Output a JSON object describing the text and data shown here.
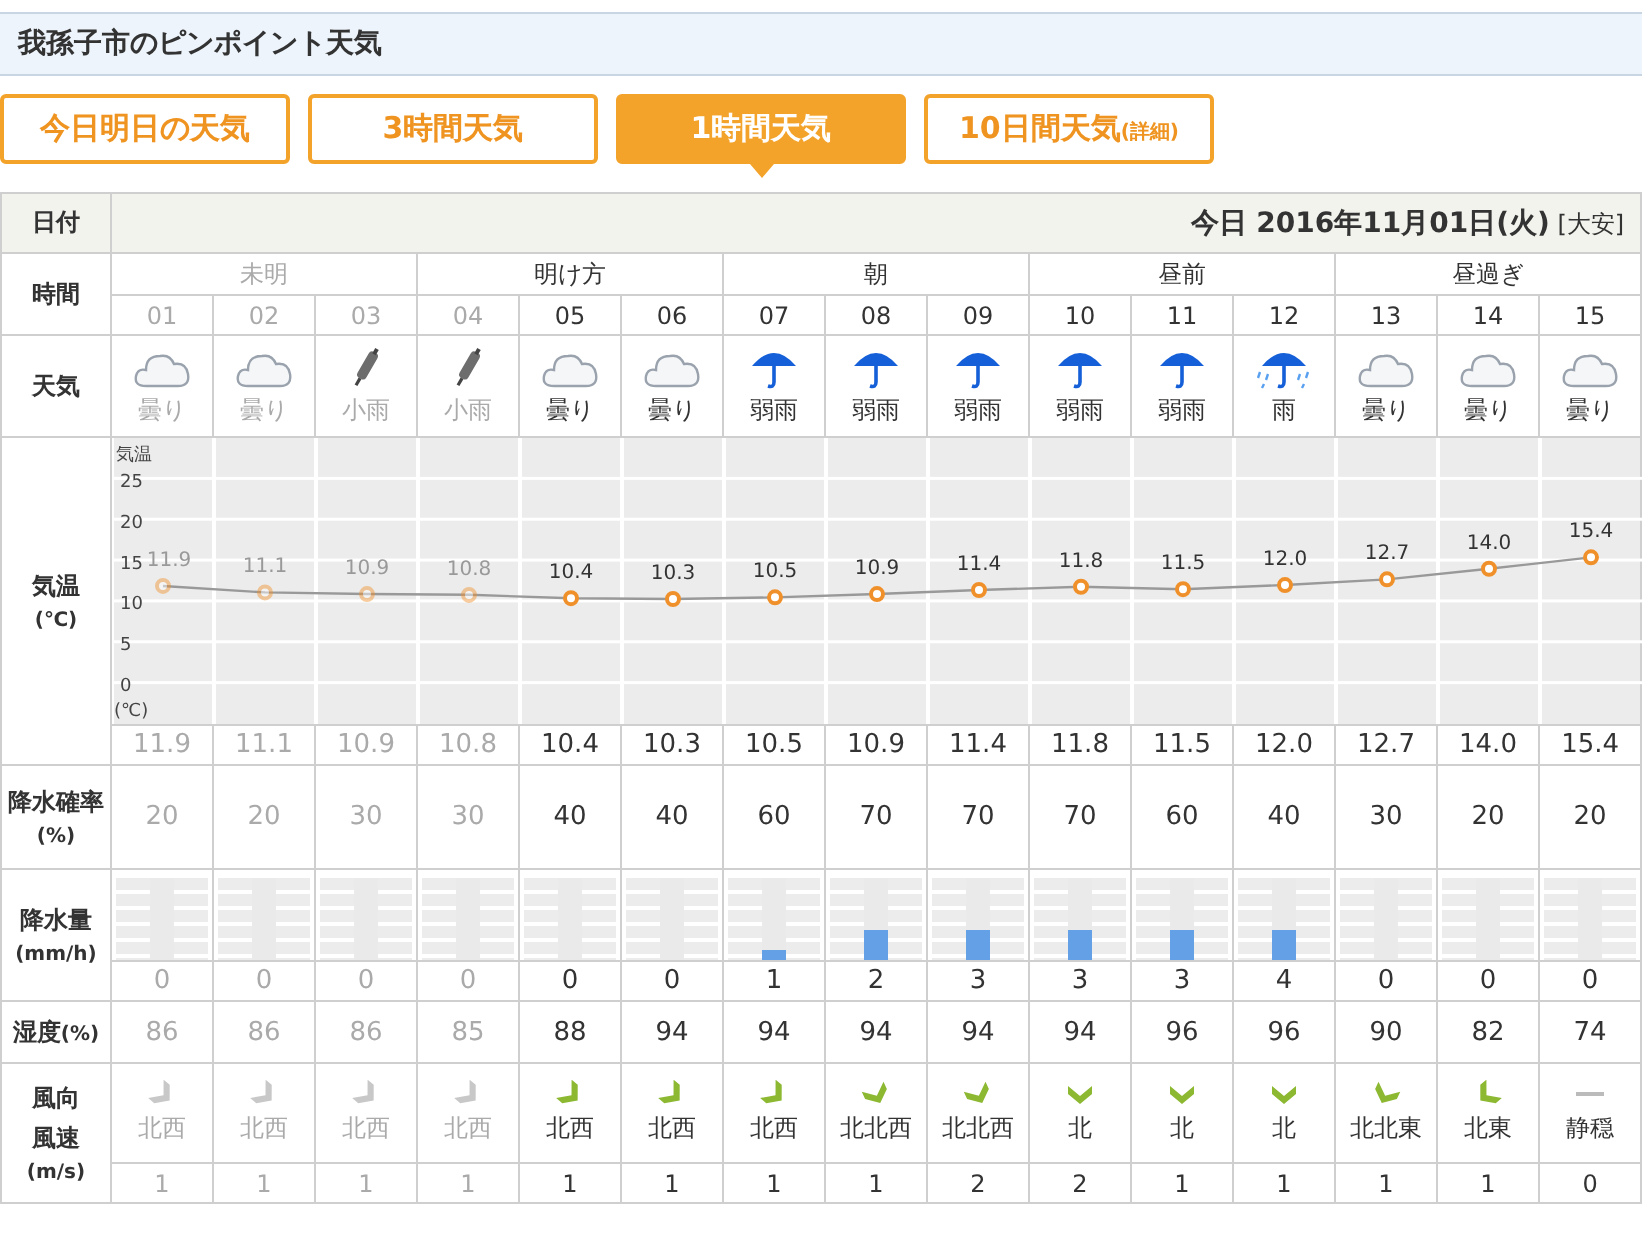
{
  "title": "我孫子市のピンポイント天気",
  "tabs": [
    {
      "label": "今日明日の天気",
      "selected": false
    },
    {
      "label": "3時間天気",
      "selected": false
    },
    {
      "label": "1時間天気",
      "selected": true
    },
    {
      "label": "10日間天気",
      "suffix": "(詳細)",
      "selected": false
    }
  ],
  "labels": {
    "date": "日付",
    "time": "時間",
    "weather": "天気",
    "temperature": "気温",
    "temperature_unit": "(℃)",
    "precip_prob": "降水確率",
    "precip_prob_unit": "(%)",
    "precip": "降水量",
    "precip_unit": "(mm/h)",
    "humidity": "湿度",
    "humidity_unit": "(%)",
    "wind_dir": "風向",
    "wind_speed": "風速",
    "wind_unit": "(m/s)"
  },
  "date": {
    "text": "今日 2016年11月01日(火)",
    "rokuyo": "[大安]"
  },
  "periods": [
    {
      "label": "未明",
      "past": true,
      "hours": [
        {
          "time": "01",
          "past": true,
          "kind": "cloud",
          "weather": "曇り",
          "temp": "11.9",
          "prob": "20",
          "precip": "0",
          "humidity": "86",
          "wind": {
            "kind": "nw",
            "direction": "北西"
          },
          "speed": "1"
        },
        {
          "time": "02",
          "past": true,
          "kind": "cloud",
          "weather": "曇り",
          "temp": "11.1",
          "prob": "20",
          "precip": "0",
          "humidity": "86",
          "wind": {
            "kind": "nw",
            "direction": "北西"
          },
          "speed": "1"
        },
        {
          "time": "03",
          "past": true,
          "kind": "closed-umbrella",
          "weather": "小雨",
          "temp": "10.9",
          "prob": "30",
          "precip": "0",
          "humidity": "86",
          "wind": {
            "kind": "nw",
            "direction": "北西"
          },
          "speed": "1"
        }
      ]
    },
    {
      "label": "明け方",
      "past": false,
      "hours": [
        {
          "time": "04",
          "past": true,
          "kind": "closed-umbrella",
          "weather": "小雨",
          "temp": "10.8",
          "prob": "30",
          "precip": "0",
          "humidity": "85",
          "wind": {
            "kind": "nw",
            "direction": "北西"
          },
          "speed": "1"
        },
        {
          "time": "05",
          "past": false,
          "kind": "cloud",
          "weather": "曇り",
          "temp": "10.4",
          "prob": "40",
          "precip": "0",
          "humidity": "88",
          "wind": {
            "kind": "nw",
            "direction": "北西"
          },
          "speed": "1"
        },
        {
          "time": "06",
          "past": false,
          "kind": "cloud",
          "weather": "曇り",
          "temp": "10.3",
          "prob": "40",
          "precip": "0",
          "humidity": "94",
          "wind": {
            "kind": "nw",
            "direction": "北西"
          },
          "speed": "1"
        }
      ]
    },
    {
      "label": "朝",
      "past": false,
      "hours": [
        {
          "time": "07",
          "past": false,
          "kind": "umbrella",
          "weather": "弱雨",
          "temp": "10.5",
          "prob": "60",
          "precip": "1",
          "level": 0.12,
          "humidity": "94",
          "wind": {
            "kind": "nw",
            "direction": "北西"
          },
          "speed": "1"
        },
        {
          "time": "08",
          "past": false,
          "kind": "umbrella",
          "weather": "弱雨",
          "temp": "10.9",
          "prob": "70",
          "precip": "2",
          "level": 0.37,
          "humidity": "94",
          "wind": {
            "kind": "nnw",
            "direction": "北北西"
          },
          "speed": "1"
        },
        {
          "time": "09",
          "past": false,
          "kind": "umbrella",
          "weather": "弱雨",
          "temp": "11.4",
          "prob": "70",
          "precip": "3",
          "level": 0.37,
          "humidity": "94",
          "wind": {
            "kind": "nnw",
            "direction": "北北西"
          },
          "speed": "2"
        }
      ]
    },
    {
      "label": "昼前",
      "past": false,
      "hours": [
        {
          "time": "10",
          "past": false,
          "kind": "umbrella",
          "weather": "弱雨",
          "temp": "11.8",
          "prob": "70",
          "precip": "3",
          "level": 0.37,
          "humidity": "94",
          "wind": {
            "kind": "n",
            "direction": "北"
          },
          "speed": "2"
        },
        {
          "time": "11",
          "past": false,
          "kind": "umbrella",
          "weather": "弱雨",
          "temp": "11.5",
          "prob": "60",
          "precip": "3",
          "level": 0.37,
          "humidity": "96",
          "wind": {
            "kind": "n",
            "direction": "北"
          },
          "speed": "1"
        },
        {
          "time": "12",
          "past": false,
          "kind": "umbrella-rain",
          "weather": "雨",
          "temp": "12.0",
          "prob": "40",
          "precip": "4",
          "level": 0.37,
          "humidity": "96",
          "wind": {
            "kind": "n",
            "direction": "北"
          },
          "speed": "1"
        }
      ]
    },
    {
      "label": "昼過ぎ",
      "past": false,
      "hours": [
        {
          "time": "13",
          "past": false,
          "kind": "cloud",
          "weather": "曇り",
          "temp": "12.7",
          "prob": "30",
          "precip": "0",
          "humidity": "90",
          "wind": {
            "kind": "nne",
            "direction": "北北東"
          },
          "speed": "1"
        },
        {
          "time": "14",
          "past": false,
          "kind": "cloud",
          "weather": "曇り",
          "temp": "14.0",
          "prob": "20",
          "precip": "0",
          "humidity": "82",
          "wind": {
            "kind": "ne",
            "direction": "北東"
          },
          "speed": "1"
        },
        {
          "time": "15",
          "past": false,
          "kind": "cloud",
          "weather": "曇り",
          "temp": "15.4",
          "prob": "20",
          "precip": "0",
          "humidity": "74",
          "wind": {
            "kind": "calm",
            "direction": "静穏"
          },
          "speed": "0"
        }
      ]
    }
  ],
  "chart_data": {
    "type": "line",
    "series": [
      {
        "name": "気温",
        "color": "#f0902a",
        "marker": "circle",
        "values": [
          11.9,
          11.1,
          10.9,
          10.8,
          10.4,
          10.3,
          10.5,
          10.9,
          11.4,
          11.8,
          11.5,
          12.0,
          12.7,
          14.0,
          15.4
        ]
      }
    ],
    "ylim": [
      -5,
      30
    ],
    "yticks": [
      0,
      5,
      10,
      15,
      20,
      25
    ],
    "value_labels": [
      "11.9",
      "11.1",
      "10.9",
      "10.8",
      "10.4",
      "10.3",
      "10.5",
      "10.9",
      "11.4",
      "11.8",
      "11.5",
      "12.0",
      "12.7",
      "14.0",
      "15.4"
    ]
  }
}
